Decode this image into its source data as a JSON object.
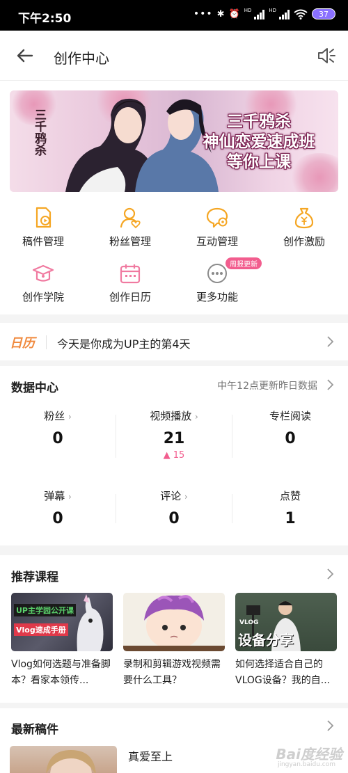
{
  "status_bar": {
    "time": "下午2:50",
    "battery": "37",
    "hd": "HD"
  },
  "header": {
    "title": "创作中心"
  },
  "banner": {
    "calligraphy": "三千鸦杀",
    "lines": [
      "三千鸦杀",
      "神仙恋爱速成班",
      "等你上课"
    ]
  },
  "quick_menu": [
    {
      "label": "稿件管理",
      "icon": "manuscript-icon"
    },
    {
      "label": "粉丝管理",
      "icon": "fans-icon"
    },
    {
      "label": "互动管理",
      "icon": "interaction-icon"
    },
    {
      "label": "创作激励",
      "icon": "money-bag-icon"
    },
    {
      "label": "创作学院",
      "icon": "academy-icon"
    },
    {
      "label": "创作日历",
      "icon": "calendar-icon"
    },
    {
      "label": "更多功能",
      "icon": "more-icon",
      "badge": "周报更新"
    }
  ],
  "calendar_strip": {
    "logo": "日历",
    "text": "今天是你成为UP主的第4天"
  },
  "data_center": {
    "title": "数据中心",
    "note": "中午12点更新昨日数据",
    "stats": [
      {
        "label": "粉丝",
        "value": "0",
        "has_arrow": true
      },
      {
        "label": "视频播放",
        "value": "21",
        "delta": "▲ 15",
        "has_arrow": true
      },
      {
        "label": "专栏阅读",
        "value": "0",
        "has_arrow": false
      },
      {
        "label": "弹幕",
        "value": "0",
        "has_arrow": true
      },
      {
        "label": "评论",
        "value": "0",
        "has_arrow": true
      },
      {
        "label": "点赞",
        "value": "1",
        "has_arrow": false
      }
    ]
  },
  "courses": {
    "title": "推荐课程",
    "items": [
      {
        "title": "Vlog如何选题与准备脚本？看家本领传...",
        "tag1": "UP主学园公开课",
        "tag2": "Vlog速成手册"
      },
      {
        "title": "录制和剪辑游戏视频需要什么工具？"
      },
      {
        "title": "如何选择适合自己的VLOG设备？我的自...",
        "tag1": "VLOG",
        "tag2": "设备分享"
      }
    ]
  },
  "latest": {
    "title": "最新稿件",
    "item_title": "真爱至上"
  },
  "watermark": {
    "text": "Bai度经验",
    "sub": "jingyan.baidu.com"
  },
  "colors": {
    "accent": "#f25d8e",
    "yellow_icon": "#f5a623",
    "pink_icon": "#f07aa0"
  }
}
